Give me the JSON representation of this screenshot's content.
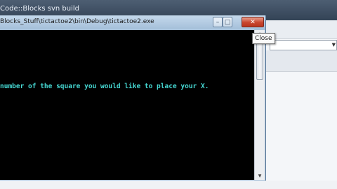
{
  "background_window": {
    "title": "Code::Blocks svn build",
    "combo_arrow": "▼"
  },
  "console": {
    "title": "Blocks_Stuff\\tictactoe2\\bin\\Debug\\tictactoe2.exe",
    "minimize_glyph": "–",
    "maximize_glyph": "□",
    "close_glyph": "✕",
    "output_line": "number of the square you would like to place your X."
  },
  "scrollbar": {
    "up_glyph": "▲",
    "down_glyph": "▼",
    "grip_glyph": "≡"
  },
  "tooltip": {
    "text": "Close"
  },
  "colors": {
    "console_text": "#46d9d4",
    "close_button": "#c8452e"
  }
}
